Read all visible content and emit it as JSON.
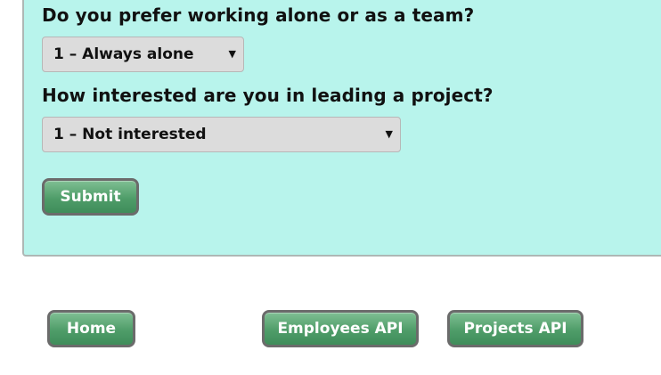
{
  "form": {
    "question_team": "Do you prefer working alone or as a team?",
    "select_team_value": "1 – Always alone",
    "question_lead": "How interested are you in leading a project?",
    "select_lead_value": "1 – Not interested",
    "submit_label": "Submit"
  },
  "nav": {
    "home_label": "Home",
    "employees_api_label": "Employees API",
    "projects_api_label": "Projects API"
  },
  "colors": {
    "panel_background": "#b8f4ec",
    "button_green": "#4f9d69",
    "select_background": "#dcdcdc"
  },
  "icons": {
    "dropdown_caret": "triangle-down"
  }
}
